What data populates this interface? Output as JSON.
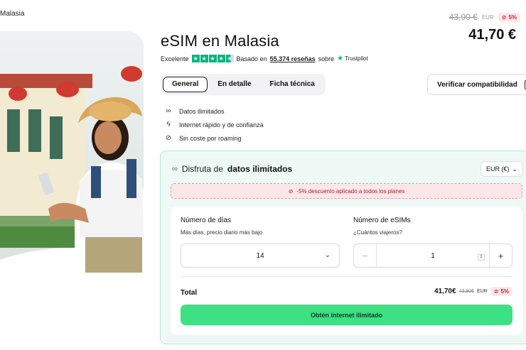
{
  "breadcrumb": "Malasia",
  "product": {
    "title": "eSIM en Malasia",
    "old_price": "43,90 €",
    "old_price_currency": "EUR",
    "discount": "5%",
    "price": "41,70 €"
  },
  "rating": {
    "label": "Excelente",
    "stars_value": 4.6,
    "based_on": "Basado en",
    "reviews": "55.374 reseñas",
    "on": "sobre",
    "provider": "Trustpilot"
  },
  "tabs": [
    {
      "label": "General",
      "active": true
    },
    {
      "label": "En detalle",
      "active": false
    },
    {
      "label": "Ficha técnica",
      "active": false
    }
  ],
  "verify_button": "Verificar compatibilidad",
  "features": [
    {
      "icon": "infinity-icon",
      "label": "Datos ilimitados"
    },
    {
      "icon": "lightning-icon",
      "label": "Internet rápido y de confianza"
    },
    {
      "icon": "no-roaming-icon",
      "label": "Sin coste por roaming"
    }
  ],
  "panel": {
    "heading_prefix": "Disfruta de",
    "heading_bold": "datos ilimitados",
    "currency": "EUR (€)",
    "discount_banner": "-5% descuento aplicado a todos los planes",
    "days_label": "Número de días",
    "days_sub": "Más días, precio diario más bajo",
    "days_value": "14",
    "esims_label": "Número de eSIMs",
    "esims_sub": "¿Cuántos viajeros?",
    "esims_value": "1",
    "minus": "−",
    "plus": "+",
    "total_label": "Total",
    "total_price": "41,70€",
    "total_old": "43,90€",
    "total_currency": "EUR",
    "total_discount": "5%",
    "cta": "Obtén internet ilimitado"
  },
  "colors": {
    "accent_green": "#3ee084",
    "panel_bg": "#eef9f5",
    "trustpilot_green": "#00b67a",
    "discount_red": "#c2273d"
  }
}
